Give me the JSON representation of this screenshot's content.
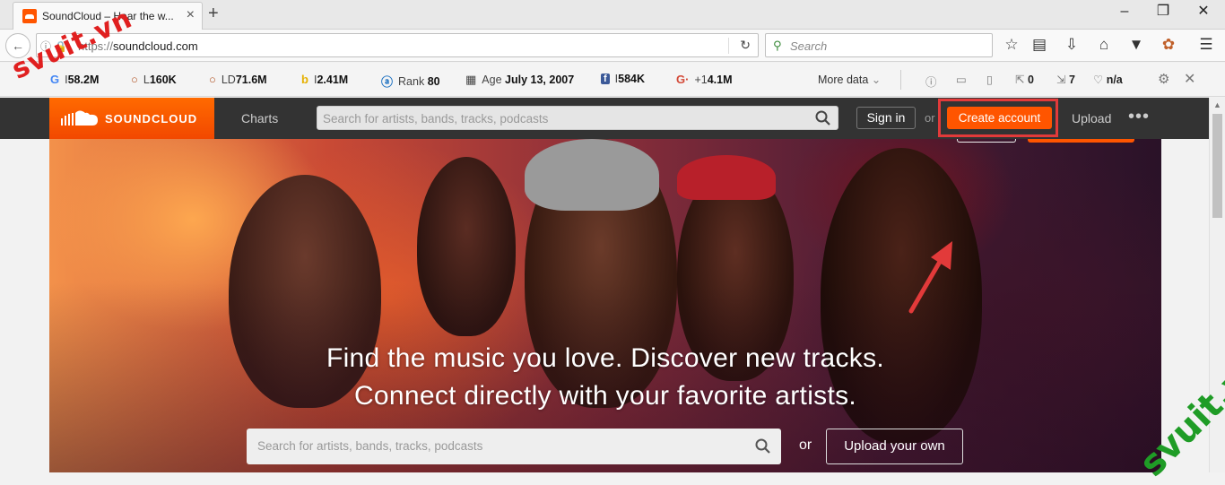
{
  "browser": {
    "tab_title": "SoundCloud – Hear the w...",
    "tab_close": "×",
    "new_tab": "+",
    "window_controls": [
      "–",
      "❐",
      "✕"
    ],
    "url_protocol": "https://",
    "url_host": "soundcloud.com",
    "search_placeholder": "Search",
    "icons": [
      "back-icon",
      "reload-icon",
      "bookmark-star-icon",
      "reading-list-icon",
      "download-icon",
      "home-icon",
      "pocket-icon",
      "extension-icon",
      "menu-icon"
    ]
  },
  "seo_toolbar": {
    "google_index": "58.2M",
    "links": "160K",
    "linking_domains": "71.6M",
    "bing_index": "2.41M",
    "rank_label": "Rank",
    "rank_value": "80",
    "age_label": "Age",
    "age_value": "July 13, 2007",
    "facebook": "584K",
    "gplus": "+1",
    "gplus_value": "4.1M",
    "more_data": "More data",
    "external_links": "0",
    "internal_links": "7",
    "pagerank": "n/a"
  },
  "watermarks": [
    "svuit.vn",
    "svuit.vn"
  ],
  "soundcloud": {
    "logo_text": "SOUNDCLOUD",
    "charts": "Charts",
    "search_placeholder": "Search for artists, bands, tracks, podcasts",
    "sign_in": "Sign in",
    "or": "or",
    "create_account": "Create account",
    "upload": "Upload",
    "more": "•••"
  },
  "hero": {
    "tagline_line1": "Find the music you love. Discover new tracks.",
    "tagline_line2": "Connect directly with your favorite artists.",
    "search_placeholder": "Search for artists, bands, tracks, podcasts",
    "or": "or",
    "upload_button": "Upload your own"
  },
  "colors": {
    "brand_orange": "#ff5500",
    "highlight_red": "#e23a3a",
    "header_bg": "#333333"
  }
}
